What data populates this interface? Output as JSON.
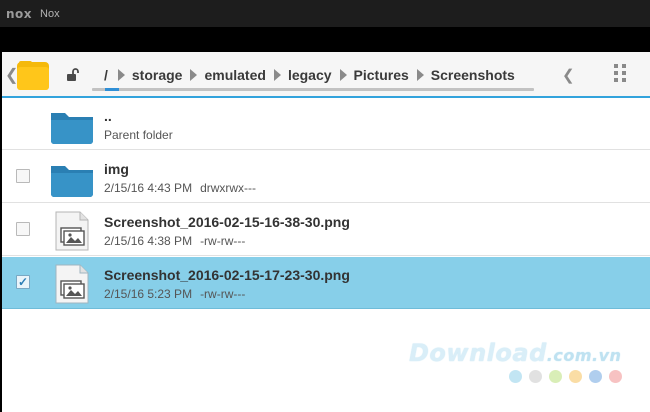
{
  "window": {
    "logo": "nox",
    "title": "Nox"
  },
  "pathbar": {
    "crumbs": [
      "/",
      "storage",
      "emulated",
      "legacy",
      "Pictures",
      "Screenshots"
    ],
    "progress": 0.03
  },
  "rows": [
    {
      "name": "..",
      "sub": "Parent folder",
      "perm": "",
      "type": "folder",
      "checkbox": false,
      "selected": false
    },
    {
      "name": "img",
      "sub": "2/15/16 4:43 PM",
      "perm": "drwxrwx---",
      "type": "folder",
      "checkbox": true,
      "checked": false,
      "selected": false
    },
    {
      "name": "Screenshot_2016-02-15-16-38-30.png",
      "sub": "2/15/16 4:38 PM",
      "perm": "-rw-rw---",
      "type": "image",
      "checkbox": true,
      "checked": false,
      "selected": false
    },
    {
      "name": "Screenshot_2016-02-15-17-23-30.png",
      "sub": "2/15/16 5:23 PM",
      "perm": "-rw-rw---",
      "type": "image",
      "checkbox": true,
      "checked": true,
      "selected": true
    }
  ],
  "watermark": {
    "main": "Download",
    "suffix": ".com.vn"
  },
  "watermark_dot_colors": [
    "#8fd0ea",
    "#c9c9c9",
    "#b9e07c",
    "#f6c15b",
    "#6fa6e0",
    "#f08f8f"
  ],
  "colors": {
    "accent": "#33a3dc",
    "selected_row": "#87cfe9",
    "folder": "#2f88bd"
  }
}
